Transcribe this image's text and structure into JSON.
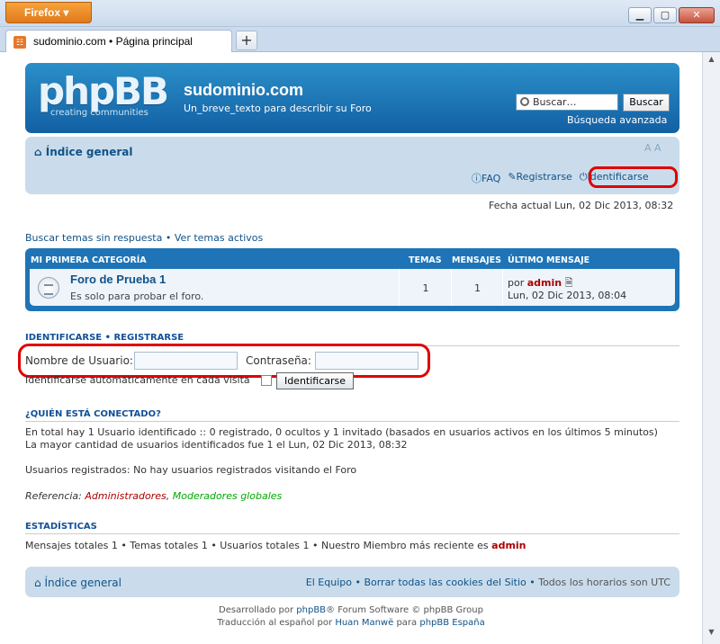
{
  "browser": {
    "app_button": "Firefox",
    "tab_title": "sudominio.com • Página principal",
    "new_tab": "+",
    "win_min": "▁",
    "win_max": "▢",
    "win_close": "✕"
  },
  "header": {
    "logo_text": "phpBB",
    "logo_sub": "creating  communities",
    "site_title": "sudominio.com",
    "site_desc": "Un_breve_texto para describir su Foro",
    "search_placeholder": "Buscar…",
    "search_button": "Buscar",
    "advanced_search": "Búsqueda avanzada"
  },
  "navbar": {
    "home": "Índice general",
    "font_size": "A A",
    "faq": "FAQ",
    "register": "Registrarse",
    "login": "Identificarse"
  },
  "date_line": "Fecha actual Lun, 02 Dic 2013, 08:32",
  "quicklinks": {
    "unanswered": "Buscar temas sin respuesta",
    "sep": "•",
    "active": "Ver temas activos"
  },
  "forum_table": {
    "category": "MI PRIMERA CATEGORÍA",
    "col_topics": "TEMAS",
    "col_posts": "MENSAJES",
    "col_last": "ÚLTIMO MENSAJE",
    "forum_title": "Foro de Prueba 1",
    "forum_desc": "Es solo para probar el foro.",
    "topics": "1",
    "posts": "1",
    "last_by_prefix": "por",
    "last_by_user": "admin",
    "last_date": "Lun, 02 Dic 2013, 08:04"
  },
  "login": {
    "title": "IDENTIFICARSE  •  REGISTRARSE",
    "username_label": "Nombre de Usuario:",
    "password_label": "Contraseña:",
    "autologin": "Identificarse automáticamente en cada visita",
    "submit": "Identificarse"
  },
  "who": {
    "title": "¿QUIÉN ESTÁ CONECTADO?",
    "line1": "En total hay 1 Usuario identificado :: 0 registrado, 0 ocultos y 1 invitado (basados en usuarios activos en los últimos 5 minutos)",
    "line2": "La mayor cantidad de usuarios identificados fue 1 el Lun, 02 Dic 2013, 08:32",
    "line3": "Usuarios registrados: No hay usuarios registrados visitando el Foro",
    "legend_prefix": "Referencia: ",
    "legend_admins": "Administradores",
    "legend_mods": "Moderadores globales"
  },
  "stats": {
    "title": "ESTADÍSTICAS",
    "text": "Mensajes totales 1 • Temas totales 1 • Usuarios totales 1 • Nuestro Miembro más reciente es ",
    "newest": "admin"
  },
  "footer": {
    "home": "Índice general",
    "team": "El Equipo",
    "cookies": "Borrar todas las cookies del Sitio",
    "timezone": "Todos los horarios son UTC",
    "powered_pre": "Desarrollado por ",
    "powered_link": "phpBB",
    "powered_post": "® Forum Software © phpBB Group",
    "trans_pre": "Traducción al español por ",
    "trans_name": "Huan Manwë",
    "trans_mid": " para ",
    "trans_link": "phpBB España"
  }
}
